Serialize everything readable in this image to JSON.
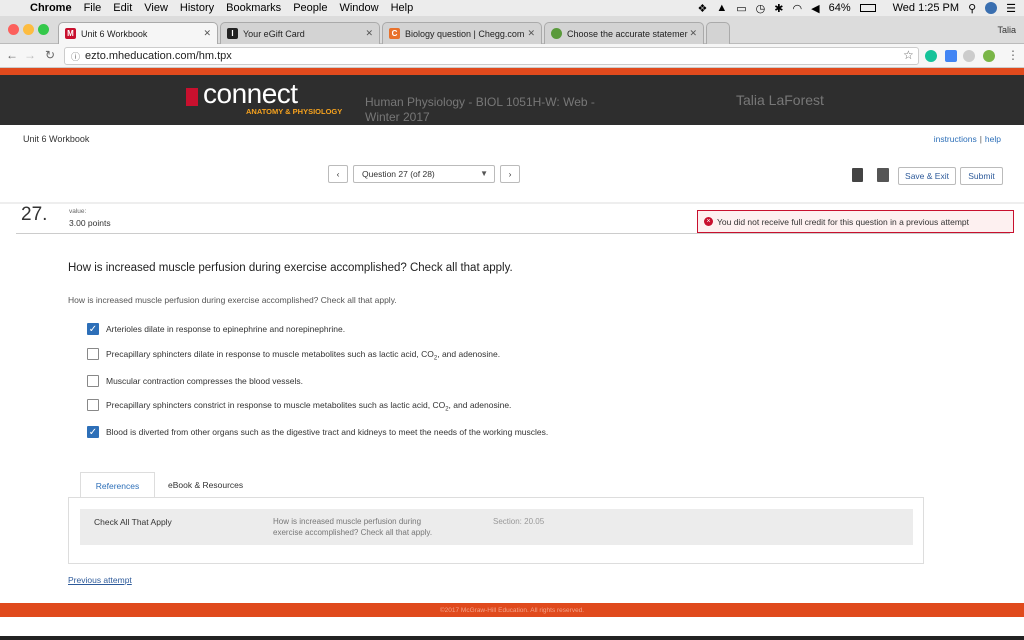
{
  "menubar": {
    "apple": "",
    "app": "Chrome",
    "items": [
      "File",
      "Edit",
      "View",
      "History",
      "Bookmarks",
      "People",
      "Window",
      "Help"
    ],
    "battery": "64%",
    "clock": "Wed 1:25 PM"
  },
  "tabs": [
    {
      "label": "Unit 6 Workbook",
      "favicon": "M",
      "color": "#c8102e"
    },
    {
      "label": "Your eGift Card",
      "favicon": "I",
      "color": "#222222"
    },
    {
      "label": "Biology question | Chegg.com",
      "favicon": "C",
      "color": "#e8712b"
    },
    {
      "label": "Choose the accurate statemer",
      "favicon": "",
      "color": "#5a9a3b"
    }
  ],
  "profile": "Talia",
  "address": {
    "url": "ezto.mheducation.com/hm.tpx"
  },
  "header": {
    "logo": "connect",
    "logo_sub": "ANATOMY & PHYSIOLOGY",
    "course_line1": "Human Physiology - BIOL 1051H-W: Web -",
    "course_line2": "Winter 2017",
    "user": "Talia LaForest"
  },
  "page": {
    "workbook_title": "Unit 6 Workbook",
    "links_instructions": "instructions",
    "links_sep": "|",
    "links_help": "help",
    "question_select": "Question 27 (of 28)",
    "save_exit": "Save & Exit",
    "submit": "Submit",
    "qnum": "27.",
    "value_label": "value:",
    "points": "3.00 points",
    "alert": "You did not receive full credit for this question in a previous attempt",
    "question_main": "How is increased muscle perfusion during exercise accomplished? Check all that apply.",
    "question_sub": "How is increased muscle perfusion during exercise accomplished? Check all that apply.",
    "options": [
      {
        "label": "Arterioles dilate in response to epinephrine and norepinephrine.",
        "checked": true
      },
      {
        "label_pre": "Precapillary sphincters dilate in response to muscle metabolites such as lactic acid, CO",
        "label_sub": "2",
        "label_post": ", and adenosine.",
        "checked": false
      },
      {
        "label": "Muscular contraction compresses the blood vessels.",
        "checked": false
      },
      {
        "label_pre": "Precapillary sphincters constrict in response to muscle metabolites such as lactic acid, CO",
        "label_sub": "2",
        "label_post": ", and adenosine.",
        "checked": false
      },
      {
        "label": "Blood is diverted from other organs such as the digestive tract and kidneys to meet the needs of the working muscles.",
        "checked": true
      }
    ],
    "ref_tab": "References",
    "ebook_tab": "eBook & Resources",
    "ref_type": "Check All That Apply",
    "ref_q_line1": "How is increased muscle perfusion during",
    "ref_q_line2": "exercise accomplished? Check all that apply.",
    "ref_section": "Section: 20.05",
    "prev_attempt": "Previous attempt",
    "footer": "©2017 McGraw-Hill Education. All rights reserved."
  }
}
